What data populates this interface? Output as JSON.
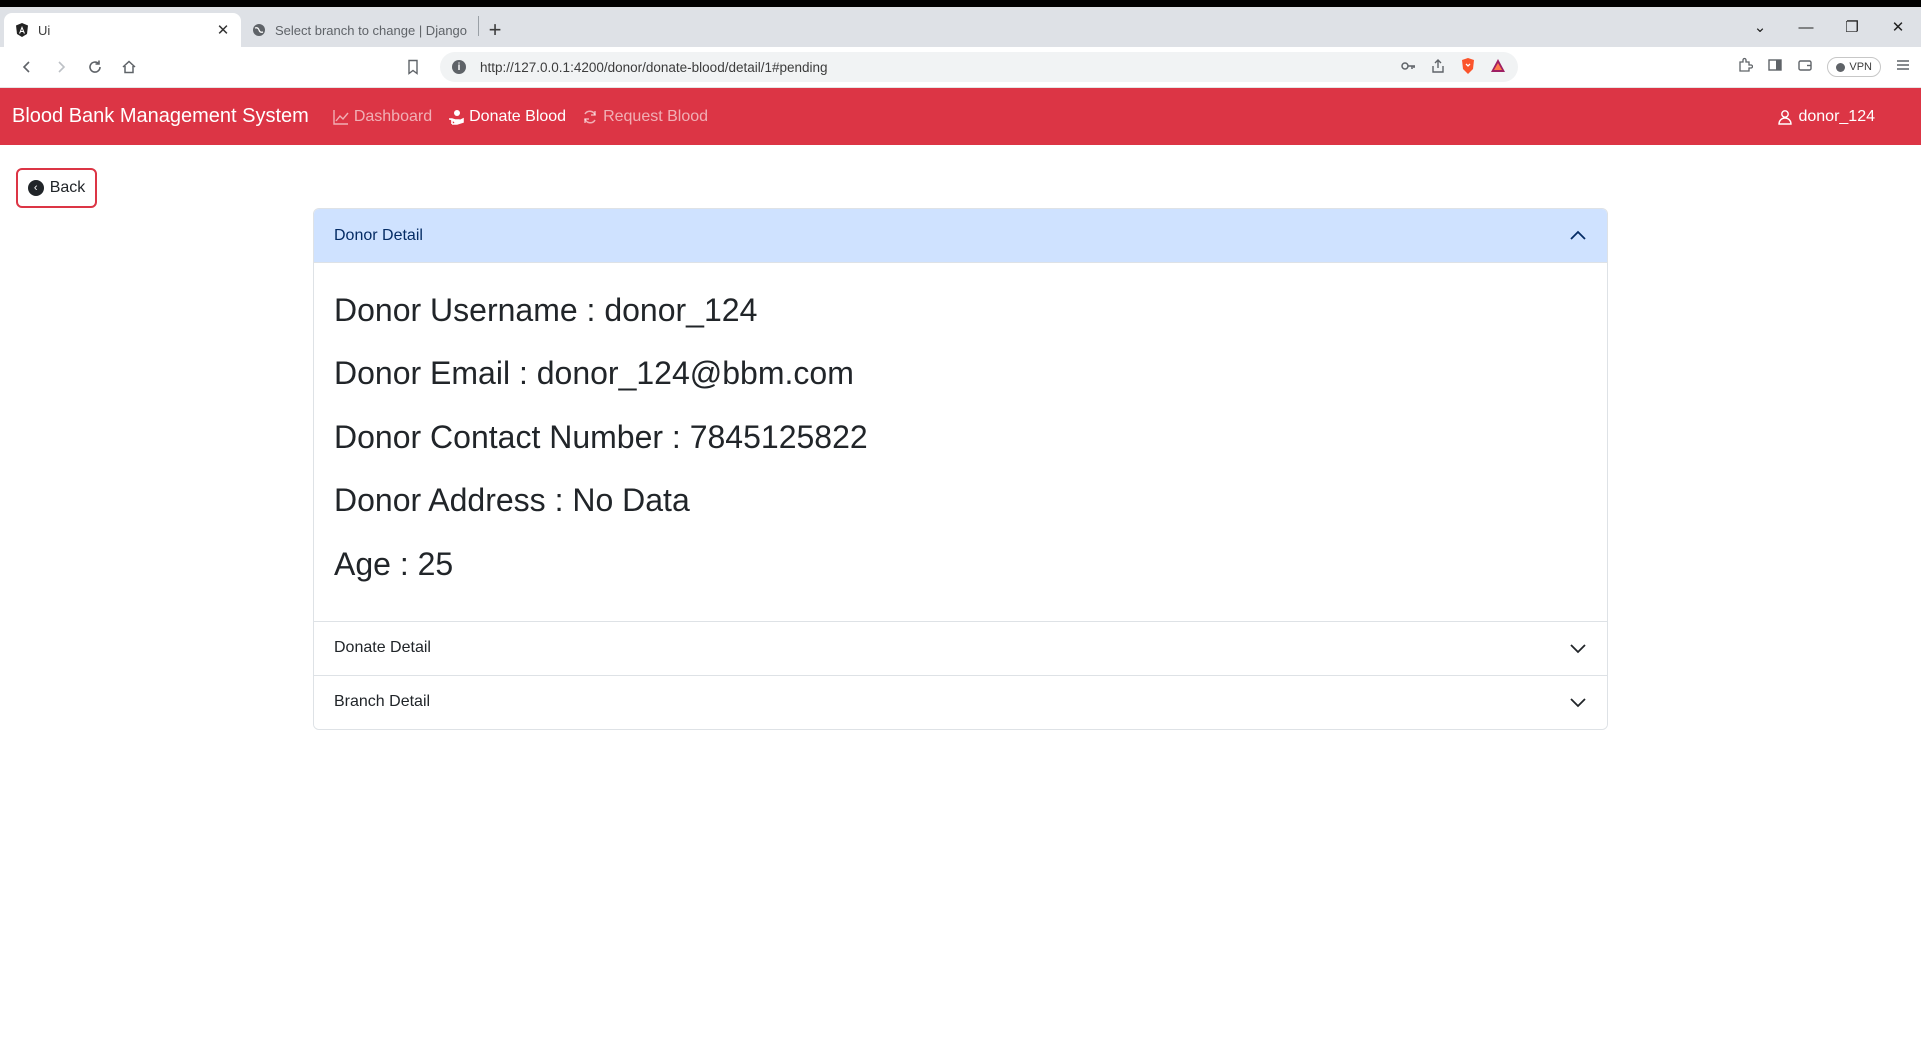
{
  "browser": {
    "tabs": [
      {
        "title": "Ui",
        "active": true
      },
      {
        "title": "Select branch to change | Django site",
        "active": false
      }
    ],
    "url": "http://127.0.0.1:4200/donor/donate-blood/detail/1#pending",
    "vpn_label": "VPN"
  },
  "app": {
    "brand": "Blood Bank Management System",
    "nav": [
      {
        "label": "Dashboard",
        "icon": "chart-line-icon",
        "active": false
      },
      {
        "label": "Donate Blood",
        "icon": "hand-holding-icon",
        "active": true
      },
      {
        "label": "Request Blood",
        "icon": "refresh-icon",
        "active": false
      }
    ],
    "user": "donor_124",
    "accent": "#dc3545"
  },
  "back_button": {
    "label": "Back"
  },
  "accordion": {
    "donor": {
      "title": "Donor Detail",
      "lines": [
        "Donor Username : donor_124",
        "Donor Email : donor_124@bbm.com",
        "Donor Contact Number : 7845125822",
        "Donor Address : No Data",
        "Age : 25"
      ]
    },
    "donate": {
      "title": "Donate Detail"
    },
    "branch": {
      "title": "Branch Detail"
    }
  }
}
